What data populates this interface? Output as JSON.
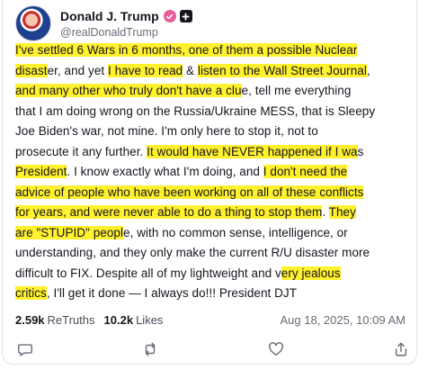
{
  "post": {
    "display_name": "Donald J. Trump",
    "handle": "@realDonaldTrump",
    "lines": [
      [
        {
          "t": "I've settled 6 Wars in 6 months, one of them a possible Nuclear",
          "h": true
        }
      ],
      [
        {
          "t": "disast",
          "h": true
        },
        {
          "t": "er, and yet ",
          "h": false
        },
        {
          "t": "I have to read",
          "h": true
        },
        {
          "t": " & ",
          "h": false
        },
        {
          "t": "listen to the Wall Street Journal",
          "h": true
        },
        {
          "t": ",",
          "h": false
        }
      ],
      [
        {
          "t": "and many other who truly don't have a clu",
          "h": true
        },
        {
          "t": "e, tell me everything",
          "h": false
        }
      ],
      [
        {
          "t": "that I am doing wrong on the Russia/Ukraine MESS, that is Sleepy",
          "h": false
        }
      ],
      [
        {
          "t": "Joe Biden's war, not mine. I'm only here to stop it, not to",
          "h": false
        }
      ],
      [
        {
          "t": "prosecute it any further. ",
          "h": false
        },
        {
          "t": "It would have NEVER happened if I wa",
          "h": true
        },
        {
          "t": "s",
          "h": false
        }
      ],
      [
        {
          "t": "President",
          "h": true
        },
        {
          "t": ". I know exactly what I'm doing, and ",
          "h": false
        },
        {
          "t": "I don't need the",
          "h": true
        }
      ],
      [
        {
          "t": "advice of people who have been working on all of these conflicts",
          "h": true
        }
      ],
      [
        {
          "t": "for years, and were never able to do a thing to stop them",
          "h": true
        },
        {
          "t": ". ",
          "h": false
        },
        {
          "t": "They",
          "h": true
        }
      ],
      [
        {
          "t": "are \"STUPID\" peopl",
          "h": true
        },
        {
          "t": "e, with no common sense, intelligence, or",
          "h": false
        }
      ],
      [
        {
          "t": "understanding, and they only make the current R/U disaster more",
          "h": false
        }
      ],
      [
        {
          "t": "difficult to FIX. Despite all of my lightweight and v",
          "h": false
        },
        {
          "t": "ery jealous",
          "h": true
        }
      ],
      [
        {
          "t": "critics",
          "h": true
        },
        {
          "t": ", I'll get it done — I always do!!! President DJT",
          "h": false
        }
      ]
    ],
    "retruths_count": "2.59k",
    "retruths_label": "ReTruths",
    "likes_count": "10.2k",
    "likes_label": "Likes",
    "timestamp": "Aug 18, 2025, 10:09 AM"
  },
  "colors": {
    "highlight": "#fff12e",
    "verified": "#e85d9a",
    "text": "#17151f",
    "muted": "#6c6a7a"
  },
  "icons": {
    "reply": "speech-bubble",
    "retruth": "repost-arrows",
    "like": "heart",
    "share": "share-arrow-up"
  }
}
